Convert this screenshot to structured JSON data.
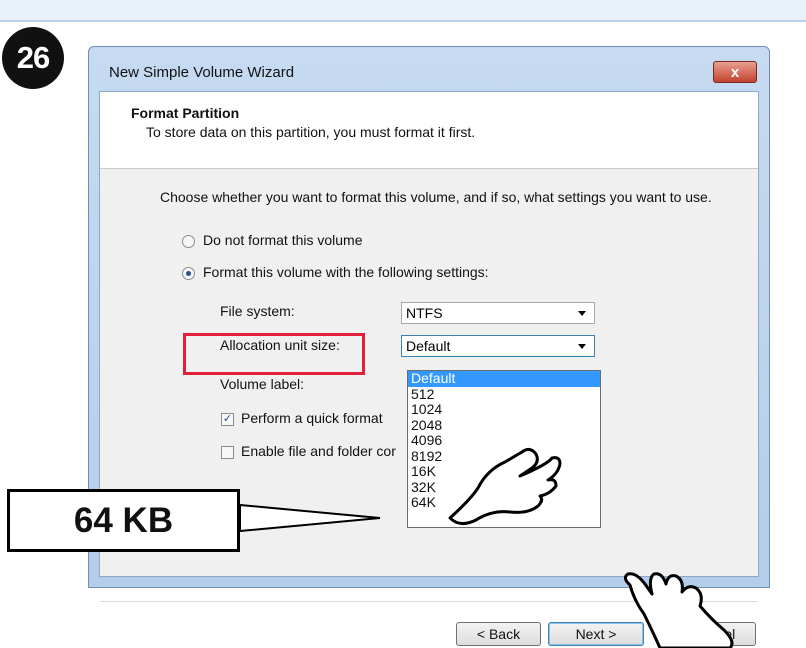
{
  "step": "26",
  "window": {
    "title": "New Simple Volume Wizard",
    "close_label": "x"
  },
  "header": {
    "title": "Format Partition",
    "subtitle": "To store data on this partition, you must format it first."
  },
  "content": {
    "intro": "Choose whether you want to format this volume, and if so, what settings you want to use.",
    "radio_no_format": "Do not format this volume",
    "radio_format": "Format this volume with the following settings:",
    "file_system_label": "File system:",
    "file_system_value": "NTFS",
    "alloc_label": "Allocation unit size:",
    "alloc_value": "Default",
    "volume_label": "Volume label:",
    "quick_format_label": "Perform a quick format",
    "compression_label": "Enable file and folder cor"
  },
  "alloc_options": [
    "Default",
    "512",
    "1024",
    "2048",
    "4096",
    "8192",
    "16K",
    "32K",
    "64K"
  ],
  "buttons": {
    "back": "< Back",
    "next": "Next >",
    "cancel": "Cancel"
  },
  "callout": "64 KB",
  "colors": {
    "highlight": "#e2203b",
    "selection": "#3399ff"
  }
}
